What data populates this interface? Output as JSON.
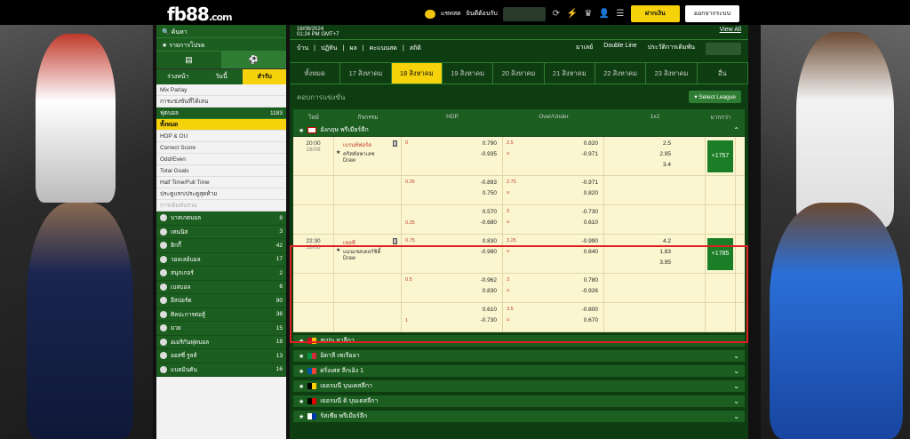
{
  "header": {
    "logo_main": "fb88",
    "logo_suffix": ".com",
    "chat_label": "แชทสด",
    "welcome": "ยินดีต้อนรับ",
    "login_btn": "ฝากเงิน",
    "logout_btn": "ออกจากระบบ"
  },
  "sidebar": {
    "search": "ค้นหา",
    "promos": "รายการโปรด",
    "tab_early": "ร่วงหน้า",
    "tab_today": "วันนี้",
    "tab_live": "สำรับ",
    "mix_parlay": "Mix Parlay",
    "bet_today": "การแข่งขันที่ได้เล่น",
    "football": "ฟุตบอล",
    "football_count": "1183",
    "menu": [
      {
        "label": "ทั้งหมด",
        "style": "yellow"
      },
      {
        "label": "HDP & OU",
        "style": ""
      },
      {
        "label": "Correct Score",
        "style": ""
      },
      {
        "label": "Odd/Even",
        "style": ""
      },
      {
        "label": "Total Goals",
        "style": ""
      },
      {
        "label": "Half Time/Full Time",
        "style": ""
      },
      {
        "label": "ประตูแรก/ประตูสุดท้าย",
        "style": ""
      },
      {
        "label": "การเดิมพันรวม",
        "style": "muted"
      }
    ],
    "sports": [
      {
        "name": "บาสเกตบอล",
        "count": "8"
      },
      {
        "name": "เทนนิส",
        "count": "3"
      },
      {
        "name": "ฮิกกี้",
        "count": "42"
      },
      {
        "name": "วอลเลย์บอล",
        "count": "17"
      },
      {
        "name": "สนุกเกอร์",
        "count": "2"
      },
      {
        "name": "เบสบอล",
        "count": "6"
      },
      {
        "name": "อีสปอร์ต",
        "count": "90"
      },
      {
        "name": "ศิลปะการต่อสู้",
        "count": "36"
      },
      {
        "name": "มวย",
        "count": "15"
      },
      {
        "name": "อเมริกันฟุตบอล",
        "count": "18"
      },
      {
        "name": "ออสซี่ รูลส์",
        "count": "13"
      },
      {
        "name": "แบดมินตัน",
        "count": "16"
      }
    ]
  },
  "main": {
    "date": "16/08/2024",
    "time": "01:24 PM GMT+7",
    "view_all": "View All",
    "filters": [
      "บ้าน",
      "ปฏิทิน",
      "ผล",
      "คะแนนสด",
      "สถิติ"
    ],
    "market": "มาเลย์",
    "line": "Double Line",
    "history": "ประวัติการเดิมพัน",
    "days": [
      "ทั้งหมด",
      "17 สิงหาคม",
      "18 สิงหาคม",
      "19 สิงหาคม",
      "20 สิงหาคม",
      "21 สิงหาคม",
      "22 สิงหาคม",
      "23 สิงหาคม",
      "อื่น"
    ],
    "subhead": "คอบการแข่งขัน",
    "select_league": "Select League",
    "cols": [
      "ไทม์",
      "กิจกรรม",
      "HDP",
      "Over/Under",
      "1x2",
      "มากกว่า"
    ],
    "league1": "อังกฤษ พรีเมียร์ลีก",
    "matches": [
      {
        "time": "20:00",
        "date": "18/08",
        "home": "เบรนท์ฟอร์ด",
        "away": "คริสตัลพาเลซ",
        "draw": "Draw",
        "more": "+1757",
        "rows": [
          {
            "hl": "0",
            "h1": "0.790",
            "h2": "-0.935",
            "ol": "2.5",
            "ou": "u",
            "o1": "0.820",
            "o2": "-0.971",
            "x1": "2.5",
            "x2": "2.95",
            "x3": "3.4"
          },
          {
            "hl": "0.25",
            "h1": "-0.893",
            "h2": "0.750",
            "ol": "2.75",
            "ou": "u",
            "o1": "-0.971",
            "o2": "0.820"
          },
          {
            "hl": "0.25",
            "h1": "0.570",
            "h2": "-0.680",
            "ol": "3",
            "ou": "u",
            "o1": "-0.730",
            "o2": "0.610"
          }
        ]
      },
      {
        "time": "22:30",
        "date": "18/08",
        "home": "เชลซี",
        "away": "แมนเชสเตอร์ซิตี้",
        "draw": "Draw",
        "more": "+1785",
        "rows": [
          {
            "hl": "0.75",
            "h1": "0.830",
            "h2": "-0.980",
            "ol": "3.25",
            "ou": "u",
            "o1": "-0.990",
            "o2": "0.840",
            "x1": "4.2",
            "x2": "1.83",
            "x3": "3.95"
          },
          {
            "hl": "0.5",
            "h1": "-0.962",
            "h2": "0.830",
            "ol": "3",
            "ou": "u",
            "o1": "0.780",
            "o2": "-0.926"
          },
          {
            "hl": "1",
            "h1": "0.610",
            "h2": "-0.730",
            "ol": "3.5",
            "ou": "u",
            "o1": "-0.800",
            "o2": "0.670"
          }
        ]
      }
    ],
    "leagues": [
      "สเปน ลาลีกา",
      "อิตาลี เซเรียอา",
      "ฝรั่งเศส ลีกเอิง 1",
      "เยอรมนี บุนเดสลีกา",
      "เยอรมนี ดิ บุนเดสลีกา",
      "รัสเซีย พรีเมียร์ลีก"
    ]
  }
}
